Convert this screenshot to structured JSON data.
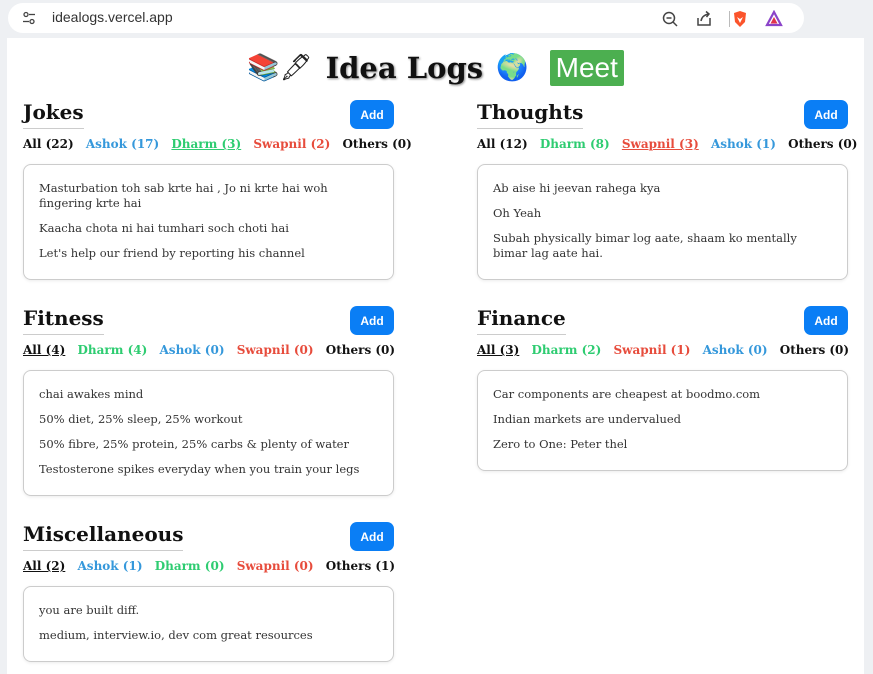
{
  "browser": {
    "url": "idealogs.vercel.app"
  },
  "header": {
    "emoji_left": "📚🖋",
    "title": "Idea Logs",
    "emoji_right": "🌍",
    "meet_label": "Meet"
  },
  "add_label": "Add",
  "jokes": {
    "title": "Jokes",
    "filters": [
      "All (22)",
      "Ashok (17)",
      "Dharm (3)",
      "Swapnil (2)",
      "Others (0)"
    ],
    "entries": [
      "Masturbation toh sab krte hai , Jo ni krte hai woh fingering krte hai",
      "Kaacha chota ni hai tumhari soch choti hai",
      "Let's help our friend by reporting his channel"
    ]
  },
  "thoughts": {
    "title": "Thoughts",
    "filters": [
      "All (12)",
      "Dharm (8)",
      "Swapnil (3)",
      "Ashok (1)",
      "Others (0)"
    ],
    "entries": [
      "Ab aise hi jeevan rahega kya",
      "Oh Yeah",
      "Subah physically bimar log aate, shaam ko mentally bimar lag aate hai."
    ]
  },
  "fitness": {
    "title": "Fitness",
    "filters": [
      "All (4)",
      "Dharm (4)",
      "Ashok (0)",
      "Swapnil (0)",
      "Others (0)"
    ],
    "entries": [
      "chai awakes mind",
      "50% diet, 25% sleep, 25% workout",
      "50% fibre, 25% protein, 25% carbs & plenty of water",
      "Testosterone spikes everyday when you train your legs"
    ]
  },
  "finance": {
    "title": "Finance",
    "filters": [
      "All (3)",
      "Dharm (2)",
      "Swapnil (1)",
      "Ashok (0)",
      "Others (0)"
    ],
    "entries": [
      "Car components are cheapest at boodmo.com",
      "Indian markets are undervalued",
      "Zero to One: Peter thel"
    ]
  },
  "misc": {
    "title": "Miscellaneous",
    "filters": [
      "All (2)",
      "Ashok (1)",
      "Dharm (0)",
      "Swapnil (0)",
      "Others (1)"
    ],
    "entries": [
      "you are built diff.",
      "medium, interview.io, dev com great resources"
    ]
  }
}
